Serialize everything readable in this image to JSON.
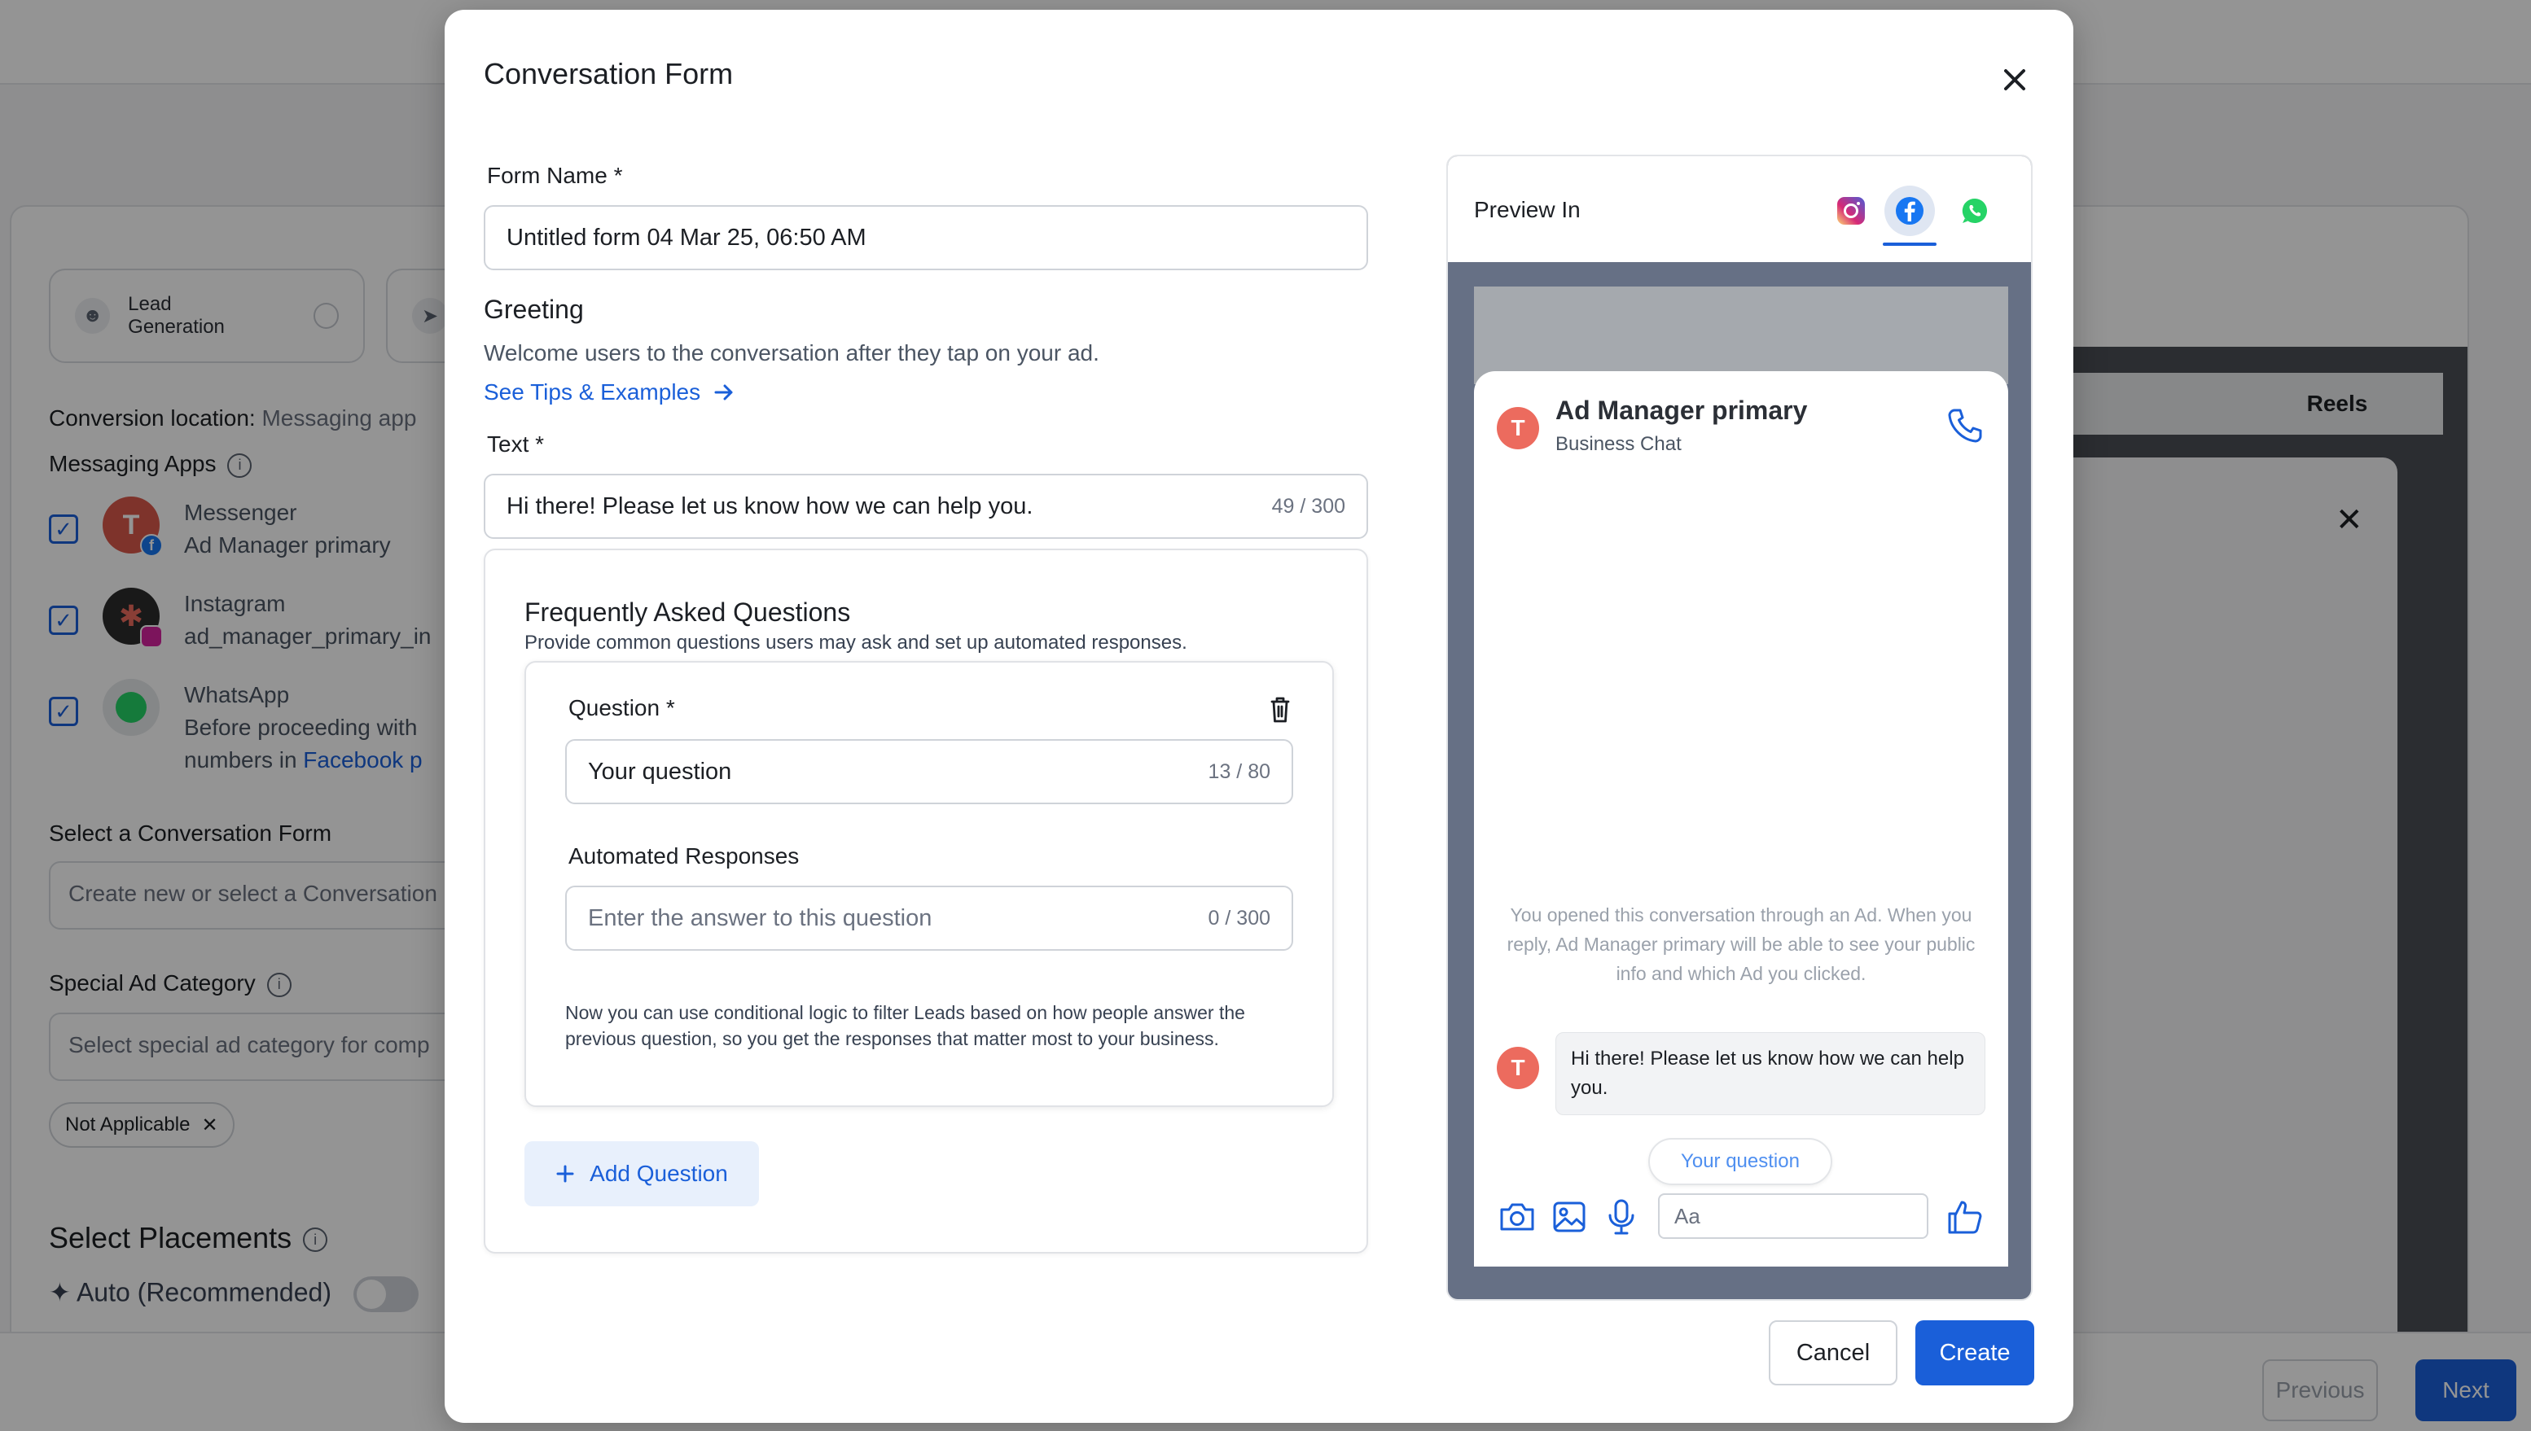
{
  "background": {
    "objective_chip": {
      "label": "Lead Generation",
      "icon": "user-icon"
    },
    "conversion_location": {
      "label": "Conversion location:",
      "value": "Messaging app"
    },
    "messaging_apps": {
      "label": "Messaging Apps",
      "apps": [
        {
          "name": "Messenger",
          "account": "Ad Manager primary",
          "avatar_letter": "T",
          "color": "#d9584a"
        },
        {
          "name": "Instagram",
          "account": "ad_manager_primary_in",
          "avatar_letter": "",
          "color": "#2b2b2b"
        },
        {
          "name": "WhatsApp",
          "account": "Before proceeding with",
          "extra": "numbers in ",
          "extra_link": "Facebook p",
          "avatar_letter": "",
          "color": "#e6e8eb"
        }
      ]
    },
    "conversation_form": {
      "label": "Select a Conversation Form",
      "placeholder": "Create new or select a Conversation"
    },
    "special_ad_category": {
      "label": "Special Ad Category",
      "placeholder": "Select special ad category for comp",
      "tag": "Not Applicable"
    },
    "placements": {
      "label": "Select Placements",
      "auto_label": "Auto (Recommended)"
    },
    "right_panel": {
      "tab": "Reels"
    },
    "footer": {
      "previous": "Previous",
      "next": "Next"
    }
  },
  "modal": {
    "title": "Conversation Form",
    "form_name": {
      "label": "Form Name *",
      "value": "Untitled form 04 Mar 25, 06:50 AM"
    },
    "greeting": {
      "heading": "Greeting",
      "description": "Welcome users to the conversation after they tap on your ad.",
      "tips_link": "See Tips & Examples"
    },
    "text": {
      "label": "Text *",
      "value": "Hi there! Please let us know how we can help you.",
      "counter": "49 / 300"
    },
    "faq": {
      "title": "Frequently Asked Questions",
      "description": "Provide common questions users may ask and set up automated responses.",
      "question": {
        "label": "Question *",
        "value": "Your question",
        "counter": "13 / 80",
        "responses_label": "Automated Responses",
        "responses_placeholder": "Enter the answer to this question",
        "responses_counter": "0 / 300",
        "note": "Now you can use conditional logic to filter Leads based on how people answer the previous question, so you get the responses that matter most to your business."
      },
      "add_question": "Add Question"
    },
    "preview": {
      "label": "Preview In",
      "platforms": [
        "instagram",
        "facebook",
        "whatsapp"
      ],
      "active_platform": "facebook",
      "page_name": "Ad Manager primary",
      "page_subtitle": "Business Chat",
      "avatar_letter": "T",
      "notice": "You opened this conversation through an Ad. When you reply, Ad Manager primary will be able to see your public info and which Ad you clicked.",
      "message": "Hi there! Please let us know how we can help you.",
      "quick_reply": "Your question",
      "composer_placeholder": "Aa"
    },
    "buttons": {
      "cancel": "Cancel",
      "create": "Create"
    }
  },
  "colors": {
    "accent": "#1a5fd9",
    "avatar": "#ec6b5e",
    "preview_bg": "#667085"
  }
}
